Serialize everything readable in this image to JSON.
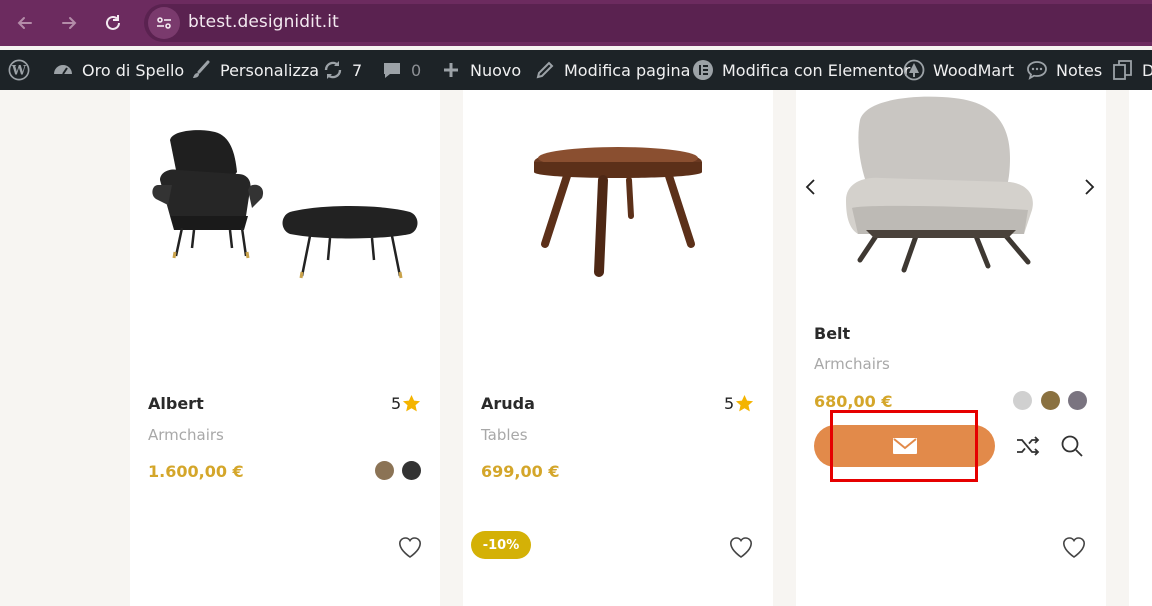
{
  "browser": {
    "url": "btest.designidit.it",
    "back_icon": "arrow-left-icon",
    "forward_icon": "arrow-right-icon",
    "reload_icon": "reload-icon",
    "site_info_icon": "site-settings-icon"
  },
  "admin_bar": {
    "items": [
      {
        "label": "",
        "icon": "wordpress-icon"
      },
      {
        "label": "Oro di Spello",
        "icon": "dashboard-icon"
      },
      {
        "label": "Personalizza",
        "icon": "brush-icon"
      },
      {
        "label": "7",
        "icon": "updates-icon"
      },
      {
        "label": "0",
        "icon": "comments-icon"
      },
      {
        "label": "Nuovo",
        "icon": "plus-icon"
      },
      {
        "label": "Modifica pagina",
        "icon": "pencil-icon"
      },
      {
        "label": "Modifica con Elementor",
        "icon": "elementor-icon"
      },
      {
        "label": "WoodMart",
        "icon": "woodmart-icon"
      },
      {
        "label": "Notes",
        "icon": "notes-icon"
      },
      {
        "label": "D",
        "icon": "duplicate-icon"
      }
    ]
  },
  "products": [
    {
      "title": "Albert",
      "category": "Armchairs",
      "price": "1.600,00 €",
      "rating": "5",
      "swatches": [
        "#8b7355",
        "#333333"
      ]
    },
    {
      "title": "Aruda",
      "category": "Tables",
      "price": "699,00 €",
      "rating": "5",
      "badge": "-10%"
    },
    {
      "title": "Belt",
      "category": "Armchairs",
      "price": "680,00 €",
      "swatches": [
        "#d0d0d0",
        "#8a7140",
        "#7a7480"
      ],
      "cta_icon": "envelope-icon",
      "compare_icon": "shuffle-icon",
      "quickview_icon": "search-icon"
    }
  ],
  "colors": {
    "accent_price": "#d4a62a",
    "cta": "#e28a4a",
    "badge": "#d4b106",
    "highlight": "#e60000",
    "browser_bar": "#6c2b5f",
    "admin_bar": "#1d2327"
  }
}
